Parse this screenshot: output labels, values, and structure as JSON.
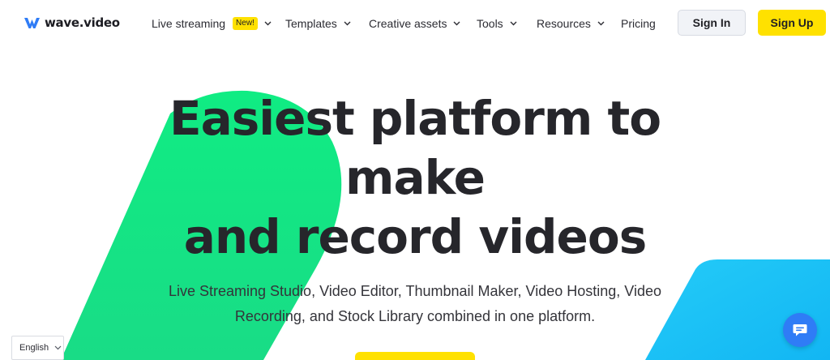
{
  "brand": {
    "name": "wave.video",
    "logo_icon": "wave-logo-icon",
    "accent": "#ffe100",
    "link_blue": "#2f7cf6"
  },
  "nav": {
    "items": [
      {
        "label": "Live streaming",
        "badge": "New!",
        "has_dropdown": true
      },
      {
        "label": "Templates",
        "has_dropdown": true
      },
      {
        "label": "Creative assets",
        "has_dropdown": true
      },
      {
        "label": "Tools",
        "has_dropdown": true
      },
      {
        "label": "Resources",
        "has_dropdown": true
      },
      {
        "label": "Pricing",
        "has_dropdown": false
      }
    ],
    "sign_in": "Sign In",
    "sign_up": "Sign Up"
  },
  "hero": {
    "title_lines": [
      "Easiest platform to",
      "make",
      "and record videos"
    ],
    "subtitle_line1": "Live Streaming Studio, Video Editor, Thumbnail Maker, Video Hosting, Video",
    "subtitle_line2": "Recording, and Stock Library combined in one platform."
  },
  "language": {
    "selected": "English"
  },
  "chat": {
    "icon": "chat-bubble-icon"
  },
  "colors": {
    "green": "#14e681",
    "blue": "#1ec3f7"
  }
}
